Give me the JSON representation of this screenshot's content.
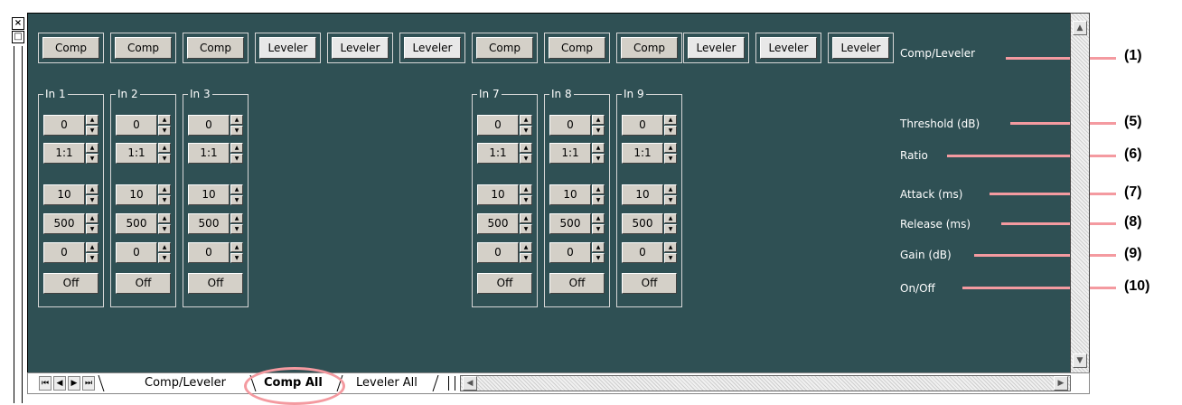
{
  "window": {
    "close_glyph": "×",
    "restore_glyph": "□"
  },
  "top_row": {
    "buttons": [
      "Comp",
      "Comp",
      "Comp",
      "Leveler",
      "Leveler",
      "Leveler",
      "Comp",
      "Comp",
      "Comp",
      "Leveler",
      "Leveler",
      "Leveler"
    ],
    "row_label": "Comp/Leveler"
  },
  "channels": [
    {
      "name": "In 1",
      "threshold": "0",
      "ratio": "1:1",
      "attack": "10",
      "release": "500",
      "gain": "0",
      "onoff": "Off"
    },
    {
      "name": "In 2",
      "threshold": "0",
      "ratio": "1:1",
      "attack": "10",
      "release": "500",
      "gain": "0",
      "onoff": "Off"
    },
    {
      "name": "In 3",
      "threshold": "0",
      "ratio": "1:1",
      "attack": "10",
      "release": "500",
      "gain": "0",
      "onoff": "Off"
    },
    {
      "name": "In 7",
      "threshold": "0",
      "ratio": "1:1",
      "attack": "10",
      "release": "500",
      "gain": "0",
      "onoff": "Off"
    },
    {
      "name": "In 8",
      "threshold": "0",
      "ratio": "1:1",
      "attack": "10",
      "release": "500",
      "gain": "0",
      "onoff": "Off"
    },
    {
      "name": "In 9",
      "threshold": "0",
      "ratio": "1:1",
      "attack": "10",
      "release": "500",
      "gain": "0",
      "onoff": "Off"
    }
  ],
  "row_labels": {
    "threshold": "Threshold (dB)",
    "ratio": "Ratio",
    "attack": "Attack (ms)",
    "release": "Release (ms)",
    "gain": "Gain (dB)",
    "onoff": "On/Off"
  },
  "callouts": {
    "comp_leveler": "(1)",
    "threshold": "(5)",
    "ratio": "(6)",
    "attack": "(7)",
    "release": "(8)",
    "gain": "(9)",
    "onoff": "(10)"
  },
  "sheet_tabs": [
    {
      "label": "Comp/Leveler",
      "active": false
    },
    {
      "label": "Comp All",
      "active": true
    },
    {
      "label": "Leveler All",
      "active": false
    }
  ],
  "nav_glyphs": [
    "⏮",
    "◀",
    "▶",
    "⏭"
  ],
  "colors": {
    "sheet_bg": "#2f5054",
    "callout_line": "#f49aa0",
    "highlight_circle": "#f49aa0"
  }
}
